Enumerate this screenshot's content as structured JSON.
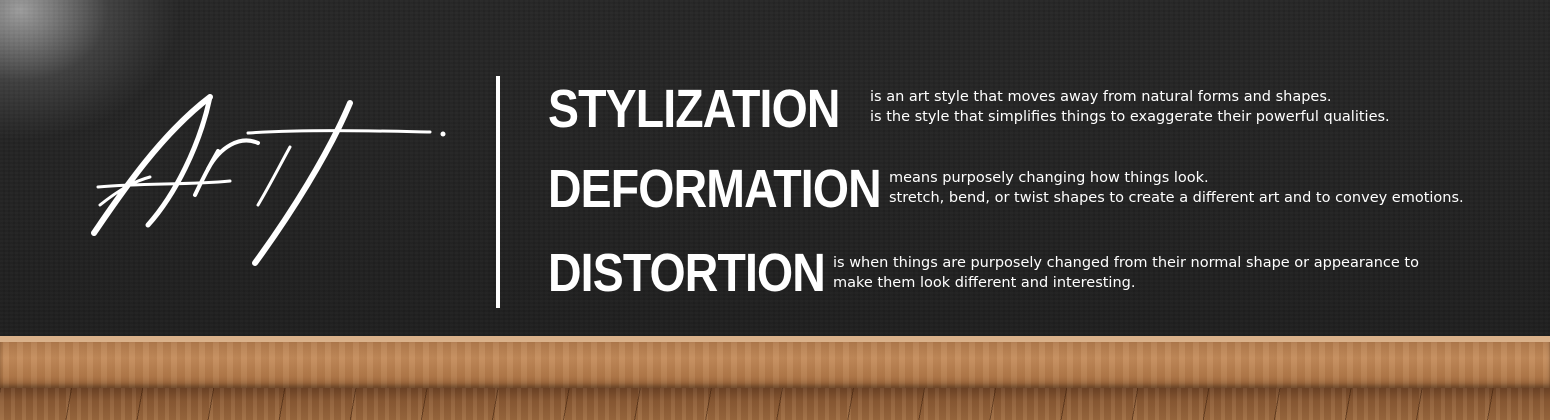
{
  "logo": {
    "text": "Art"
  },
  "entries": [
    {
      "term": "STYLIZATION",
      "lines": [
        "is an art style that moves away from natural forms and shapes.",
        "is the style that simplifies things to exaggerate their powerful qualities."
      ]
    },
    {
      "term": "DEFORMATION",
      "lines": [
        "means purposely changing how things look.",
        "stretch, bend, or twist shapes to create a different art and to convey emotions."
      ]
    },
    {
      "term": "DISTORTION",
      "lines": [
        "is when things are purposely changed from their normal shape or appearance to",
        "make them look different and interesting."
      ]
    }
  ],
  "colors": {
    "wall": "#222222",
    "text": "#ffffff",
    "wood": "#b27c4f"
  }
}
